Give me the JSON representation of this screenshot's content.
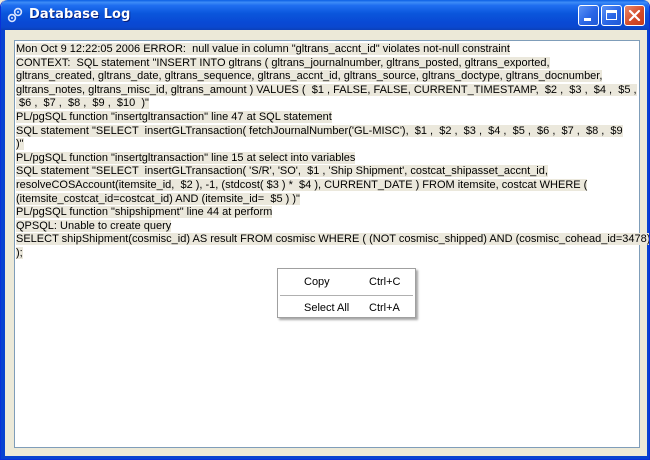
{
  "window": {
    "title": "Database Log"
  },
  "log": {
    "lines": [
      "Mon Oct 9 12:22:05 2006 ERROR:  null value in column \"gltrans_accnt_id\" violates not-null constraint",
      "CONTEXT:  SQL statement \"INSERT INTO gltrans ( gltrans_journalnumber, gltrans_posted, gltrans_exported,",
      "gltrans_created, gltrans_date, gltrans_sequence, gltrans_accnt_id, gltrans_source, gltrans_doctype, gltrans_docnumber,",
      "gltrans_notes, gltrans_misc_id, gltrans_amount ) VALUES (  $1 , FALSE, FALSE, CURRENT_TIMESTAMP,  $2 ,  $3 ,  $4 ,  $5 ,",
      " $6 ,  $7 ,  $8 ,  $9 ,  $10  )\"",
      "PL/pgSQL function \"insertgltransaction\" line 47 at SQL statement",
      "SQL statement \"SELECT  insertGLTransaction( fetchJournalNumber('GL-MISC'),  $1 ,  $2 ,  $3 ,  $4 ,  $5 ,  $6 ,  $7 ,  $8 ,  $9",
      ")\"",
      "PL/pgSQL function \"insertgltransaction\" line 15 at select into variables",
      "SQL statement \"SELECT  insertGLTransaction( 'S/R', 'SO',  $1 , 'Ship Shipment', costcat_shipasset_accnt_id,",
      "resolveCOSAccount(itemsite_id,  $2 ), -1, (stdcost( $3 ) *  $4 ), CURRENT_DATE ) FROM itemsite, costcat WHERE (",
      "(itemsite_costcat_id=costcat_id) AND (itemsite_id=  $5 ) )\"",
      "PL/pgSQL function \"shipshipment\" line 44 at perform",
      "QPSQL: Unable to create query",
      "SELECT shipShipment(cosmisc_id) AS result FROM cosmisc WHERE ( (NOT cosmisc_shipped) AND (cosmisc_cohead_id=3478)",
      ");"
    ]
  },
  "context_menu": {
    "copy_label": "Copy",
    "copy_shortcut": "Ctrl+C",
    "select_all_label": "Select All",
    "select_all_shortcut": "Ctrl+A"
  },
  "icons": {
    "app": "gear-icon",
    "minimize": "minimize-icon",
    "maximize": "maximize-icon",
    "close": "close-icon"
  },
  "colors": {
    "titlebar": "#0a56dc",
    "close_button": "#d44c2a",
    "selection_highlight": "#ebe8dc",
    "window_bg": "#ece9d8"
  }
}
